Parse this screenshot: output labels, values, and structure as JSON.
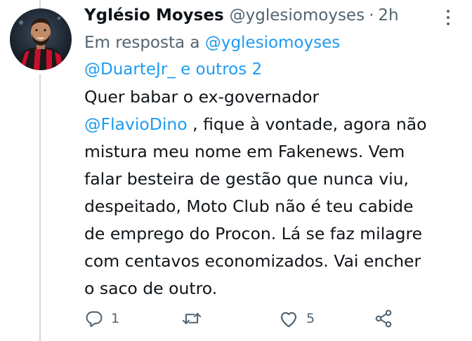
{
  "tweet": {
    "display_name": "Yglésio Moyses",
    "handle": "@yglesiomoyses",
    "separator": "·",
    "time": "2h",
    "reply_prefix": "Em resposta a",
    "reply_mention_1": "@yglesiomoyses",
    "reply_mention_2": "@DuarteJr_",
    "reply_suffix": "e outros 2",
    "body": {
      "line1": "Quer babar o ex-governador",
      "line2_mention": "@FlavioDino",
      "line2_rest": " , fique à vontade, agora não",
      "line3": "mistura meu nome em Fakenews. Vem",
      "line4": "falar besteira de gestão que nunca viu,",
      "line5": "despeitado,  Moto Club não é teu cabide",
      "line6": "de emprego do Procon. Lá se faz milagre",
      "line7": "com centavos economizados. Vai encher",
      "line8": "o saco de outro."
    },
    "actions": {
      "reply_count": "1",
      "retweet_count": "",
      "like_count": "5"
    },
    "icons": {
      "reply": "reply-icon",
      "retweet": "retweet-icon",
      "like": "heart-icon",
      "share": "share-icon",
      "more": "more-icon"
    },
    "colors": {
      "text": "#0f1419",
      "secondary": "#536471",
      "link": "#1d9bf0",
      "thread_line": "#cfd9de"
    }
  }
}
